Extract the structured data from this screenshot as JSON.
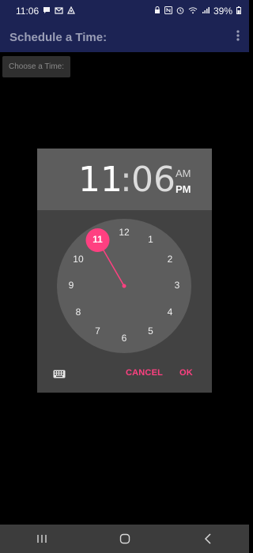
{
  "status_bar": {
    "time": "11:06",
    "battery": "39%",
    "left_icons": [
      "chat-bubble-icon",
      "mail-icon",
      "app-icon"
    ],
    "right_icons": [
      "lock-icon",
      "nfc-icon",
      "alarm-icon",
      "wifi-icon",
      "signal-icon",
      "battery-icon"
    ]
  },
  "app_bar": {
    "title": "Schedule a Time:",
    "menu_icon": "overflow-menu-icon"
  },
  "main": {
    "choose_button_label": "Choose a Time:"
  },
  "time_picker": {
    "hour": "11",
    "colon": ":",
    "minute": "06",
    "am_label": "AM",
    "pm_label": "PM",
    "selected_period": "PM",
    "selected_hour": 11,
    "clock_numbers": [
      "12",
      "1",
      "2",
      "3",
      "4",
      "5",
      "6",
      "7",
      "8",
      "9",
      "10",
      "11"
    ],
    "cancel_label": "CANCEL",
    "ok_label": "OK",
    "accent_color": "#ff4081",
    "keyboard_icon": "keyboard-icon"
  },
  "nav_bar": {
    "items": [
      "recent-apps-icon",
      "home-icon",
      "back-icon"
    ]
  }
}
